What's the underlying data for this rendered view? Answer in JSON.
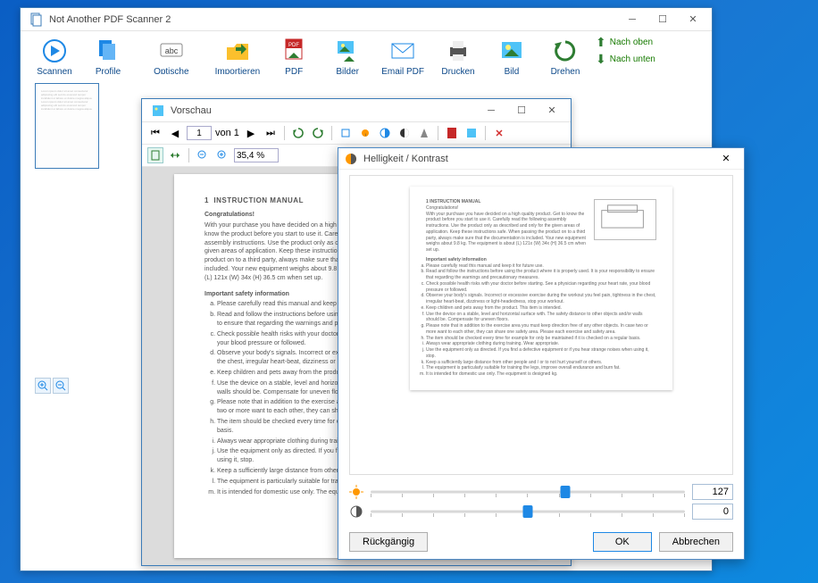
{
  "app": {
    "title": "Not Another PDF Scanner 2"
  },
  "toolbar": {
    "scan": "Scannen",
    "profile": "Profile",
    "ocr": "Optische\nTexterkennung",
    "import": "Importieren",
    "pdf_save": "PDF\nspeichern",
    "img_save": "Bilder\nspeichern",
    "email_pdf": "Email PDF",
    "print": "Drucken",
    "image": "Bild",
    "rotate": "Drehen",
    "move_up": "Nach oben",
    "move_down": "Nach unten"
  },
  "preview": {
    "title": "Vorschau",
    "page_current": "1",
    "page_of": "von 1",
    "zoom": "35,4 %"
  },
  "doc": {
    "heading_num": "1",
    "heading": "INSTRUCTION MANUAL",
    "congrats": "Congratulations!",
    "intro": "With your purchase you have decided on a high quality product. Get to know the product before you start to use it. Carefully read the following assembly instructions. Use the product only as described and only for the given areas of application. Keep these instructions safe. When passing the product on to a third party, always make sure that the documentation is included. Your new equipment weighs about 9.8 kg. The equipment is about (L) 121x (W) 34x (H) 36.5 cm when set up.",
    "safety_h": "Important safety information",
    "items": [
      "Please carefully read this manual and keep it for future use.",
      "Read and follow the instructions before using the product where it is properly used. It is your responsibility to ensure that regarding the warnings and precautionary measures.",
      "Check possible health risks with your doctor before starting. See a physician regarding your heart rate, your blood pressure or followed.",
      "Observe your body's signals. Incorrect or excessive exercise during the workout you feel pain, tightness in the chest, irregular heart-beat, dizziness or light-headedness, stop your workout.",
      "Keep children and pets away from the product. This item is intended.",
      "Use the device on a stable, level and horizontal surface with. The safety distance to other objects and/or walls should be. Compensate for uneven floors.",
      "Please note that in addition to the exercise area you must keep direction free of any other objects. In case two or more want to each other, they can share one safety area. Please each exercise and safety area.",
      "The item should be checked every time for example for only be maintained if it is checked on a regular basis.",
      "Always wear appropriate clothing during training. Wear appropriate.",
      "Use the equipment only as directed. If you find a defective equipment or if you hear strange noises when using it, stop.",
      "Keep a sufficiently large distance from other people and / or to not hurt yourself or others.",
      "The equipment is particularly suitable for training the legs, improve overall endurance and burn fat.",
      "It is intended for domestic use only. The equipment is designed kg."
    ]
  },
  "dialog": {
    "title": "Helligkeit / Kontrast",
    "brightness": "127",
    "contrast": "0",
    "undo": "Rückgängig",
    "ok": "OK",
    "cancel": "Abbrechen"
  }
}
